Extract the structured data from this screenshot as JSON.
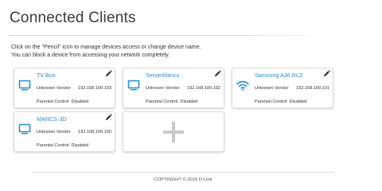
{
  "page": {
    "title": "Connected Clients",
    "intro_line1": "Click on the \"Pencil\" icon to manage devices access or change device name.",
    "intro_line2": "You can block a device from accessing your network completely."
  },
  "clients": [
    {
      "name": "TV Box",
      "vendor": "Unknown Vendor",
      "ip": "192.168.100.103",
      "parental": "Parental Control: Disabled",
      "icon": "monitor-icon"
    },
    {
      "name": "ServerMancs",
      "vendor": "Unknown Vendor",
      "ip": "192.168.100.102",
      "parental": "Parental Control: Disabled",
      "icon": "monitor-icon"
    },
    {
      "name": "Samsung A36 RLZ",
      "vendor": "Unknown Vendor",
      "ip": "192.168.100.101",
      "parental": "Parental Control: Disabled",
      "icon": "wifi-icon"
    },
    {
      "name": "MANCS-3D",
      "vendor": "Unknown Vendor",
      "ip": "192.168.100.100",
      "parental": "Parental Control: Disabled",
      "icon": "monitor-icon"
    }
  ],
  "add_card_icon": "plus-icon",
  "colors": {
    "accent": "#2a8ccf",
    "device_icon": "#1f8fd3"
  },
  "footer": {
    "copyright": "COPYRIGHT © 2016 D-Link"
  }
}
